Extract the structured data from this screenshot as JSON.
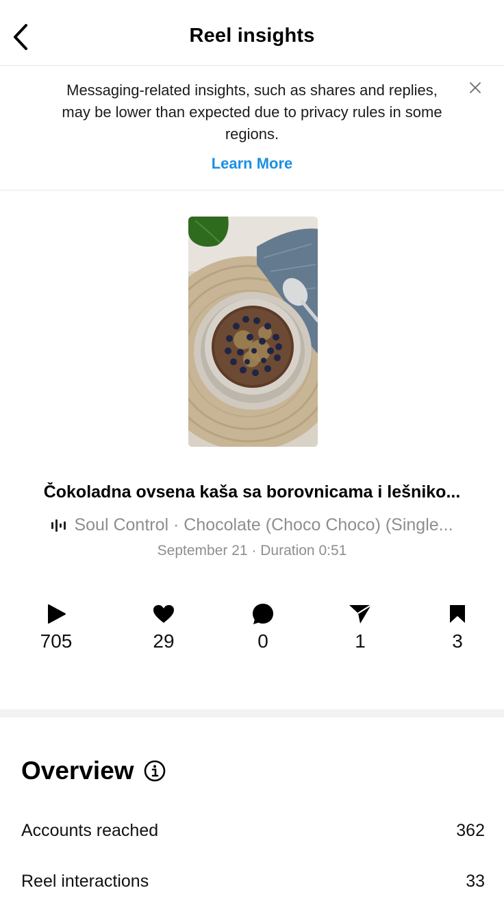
{
  "header": {
    "title": "Reel insights"
  },
  "banner": {
    "message": "Messaging-related insights, such as shares and replies, may be lower than expected due to privacy rules in some regions.",
    "link_label": "Learn More"
  },
  "reel": {
    "title": "Čokoladna ovsena kaša sa borovnicama i lešniko...",
    "audio": "Soul Control · Chocolate (Choco Choco) (Single...",
    "meta": "September 21 · Duration 0:51"
  },
  "stats": {
    "plays": "705",
    "likes": "29",
    "comments": "0",
    "shares": "1",
    "saves": "3"
  },
  "overview": {
    "title": "Overview",
    "metrics": [
      {
        "label": "Accounts reached",
        "value": "362"
      },
      {
        "label": "Reel interactions",
        "value": "33"
      }
    ]
  },
  "icons": {
    "back": "chevron-left-icon",
    "close": "close-icon",
    "audio": "audio-wave-icon",
    "plays": "play-icon",
    "likes": "heart-icon",
    "comments": "comment-bubble-icon",
    "shares": "paper-plane-icon",
    "saves": "bookmark-icon",
    "info": "info-icon"
  },
  "colors": {
    "link": "#1a8fe3",
    "secondary_text": "#8e8e8e",
    "divider": "#e6e6e6"
  }
}
